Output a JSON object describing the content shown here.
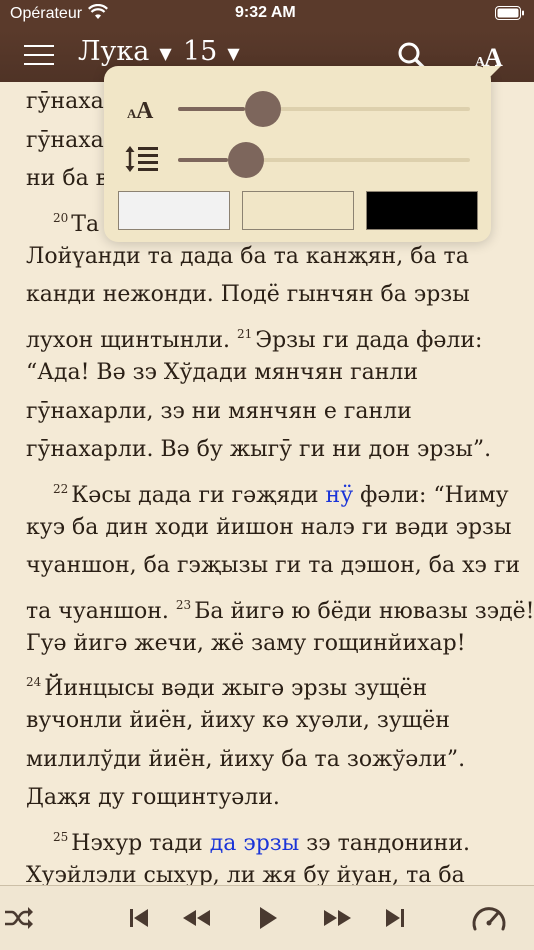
{
  "status_bar": {
    "carrier": "Opérateur",
    "time": "9:32 AM"
  },
  "nav": {
    "book": "Лука",
    "chapter": "15"
  },
  "text_lines": [
    {
      "segments": [
        {
          "t": "гӯнахар"
        }
      ]
    },
    {
      "segments": [
        {
          "t": "гӯнахар"
        }
      ]
    },
    {
      "segments": [
        {
          "t": "ни ба ва"
        }
      ]
    },
    {
      "indent": true,
      "segments": [
        {
          "v": "20"
        },
        {
          "t": "Та"
        }
      ]
    },
    {
      "segments": [
        {
          "t": "Лойүанди та дада ба та канҗян, ба та"
        }
      ]
    },
    {
      "segments": [
        {
          "t": "канди нежонди. Подё гынчян ба эрзы"
        }
      ]
    },
    {
      "segments": [
        {
          "t": "лухон щинтынли. "
        },
        {
          "v": "21"
        },
        {
          "t": "Эрзы ги дада фəли:"
        }
      ]
    },
    {
      "segments": [
        {
          "t": "“Ада! Вə зэ Хўдади мянчян ганли"
        }
      ]
    },
    {
      "segments": [
        {
          "t": "гӯнахарли, зэ ни мянчян е ганли"
        }
      ]
    },
    {
      "segments": [
        {
          "t": "гӯнахарли. Вə бу жыгӯ ги ни дон эрзы”."
        }
      ]
    },
    {
      "indent": true,
      "segments": [
        {
          "v": "22"
        },
        {
          "t": "Кəсы дада ги гəҗяди "
        },
        {
          "l": "нӱ"
        },
        {
          "t": " фəли: “Ниму"
        }
      ]
    },
    {
      "segments": [
        {
          "t": "куэ ба дин ходи йишон налэ ги вəди эрзы"
        }
      ]
    },
    {
      "segments": [
        {
          "t": "чуаншон, ба гэҗызы ги та дэшон, ба хэ ги"
        }
      ]
    },
    {
      "segments": [
        {
          "t": "та чуаншон. "
        },
        {
          "v": "23"
        },
        {
          "t": "Ба йигə ю бёди нювазы зэдё!"
        }
      ]
    },
    {
      "segments": [
        {
          "t": "Гуə йигə жечи, жё заму гощинйихар!"
        }
      ]
    },
    {
      "segments": [
        {
          "v": "24"
        },
        {
          "t": "Йинцысы вəди жыгə эрзы зущён"
        }
      ]
    },
    {
      "segments": [
        {
          "t": "вучонли йиён, йиху кə хуəли, зущён"
        }
      ]
    },
    {
      "segments": [
        {
          "t": "милилўди йиён, йиху ба та зожўəли”."
        }
      ]
    },
    {
      "segments": [
        {
          "t": "Даҗя ду гощинтуəли."
        }
      ]
    },
    {
      "indent": true,
      "segments": [
        {
          "v": "25"
        },
        {
          "t": "Нэхур тади "
        },
        {
          "l": "да эрзы"
        },
        {
          "t": " зэ тандонини."
        }
      ]
    },
    {
      "segments": [
        {
          "t": "Хуэйлэли сыхур, ли жя бу йуан, та ба"
        }
      ]
    }
  ],
  "popover": {
    "font_size_level": 0.23,
    "line_spacing_level": 0.17,
    "themes": [
      {
        "name": "light",
        "color": "#f2f2f2"
      },
      {
        "name": "sepia",
        "color": "#f1e6c7"
      },
      {
        "name": "dark",
        "color": "#000000"
      }
    ]
  },
  "colors": {
    "nav_bg": "#5a3a2b",
    "page_bg": "#f4ead6",
    "link": "#1a34d8",
    "slider": "#7d665c"
  },
  "icons": [
    "menu-icon",
    "search-icon",
    "font-size-icon",
    "line-spacing-icon",
    "shuffle-icon",
    "skip-back-icon",
    "rewind-icon",
    "play-icon",
    "fast-forward-icon",
    "skip-forward-icon",
    "speed-gauge-icon"
  ]
}
